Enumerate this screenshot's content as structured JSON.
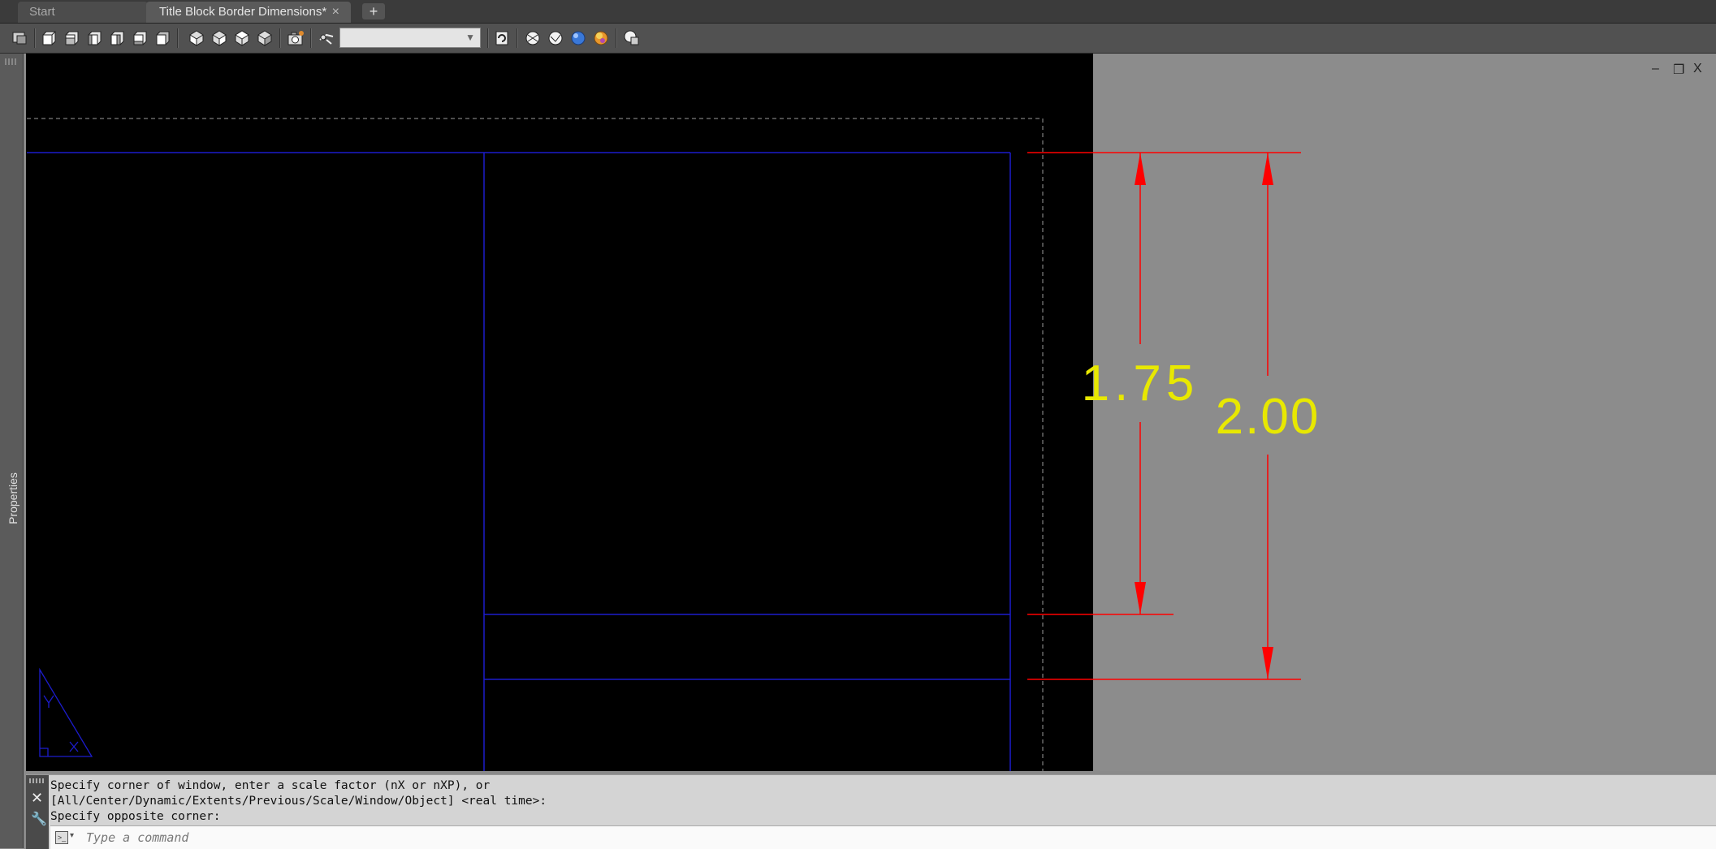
{
  "tabs": [
    {
      "label": "Start",
      "active": false
    },
    {
      "label": "Title Block Border Dimensions*",
      "active": true
    }
  ],
  "tab_close_icon": "close-icon",
  "new_tab_label": "+",
  "toolbar": {
    "view_select_value": ""
  },
  "properties_palette": {
    "label": "Properties"
  },
  "window_controls": {
    "minimize": "‒",
    "restore": "❐",
    "close": "X"
  },
  "dimensions": [
    {
      "value": "1.75",
      "color": "#e8e800"
    },
    {
      "value": "2.00",
      "color": "#e8e800"
    }
  ],
  "colors": {
    "model_background": "#000000",
    "paper_background": "#8c8c8c",
    "border_lines": "#1c1ccc",
    "dimension_lines": "#ff0000",
    "dimension_text": "#e8e800"
  },
  "command_line": {
    "history": [
      "Specify corner of window, enter a scale factor (nX or nXP), or",
      "[All/Center/Dynamic/Extents/Previous/Scale/Window/Object] <real time>:",
      "Specify opposite corner:"
    ],
    "placeholder": "Type a command",
    "close_label": "✕",
    "customize_label": "🔧"
  }
}
